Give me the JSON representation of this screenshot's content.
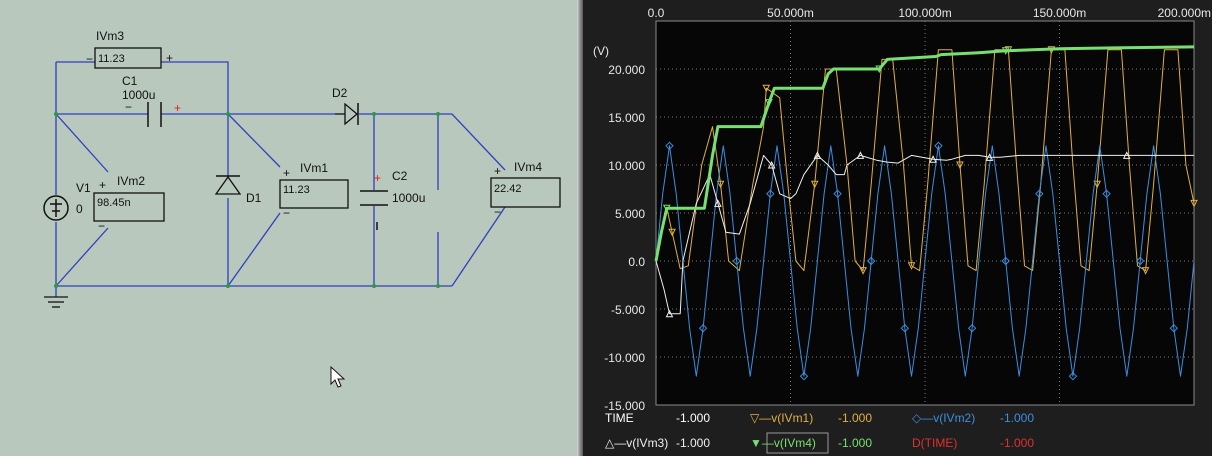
{
  "schematic": {
    "components": {
      "ivm3": {
        "name": "IVm3",
        "value": "11.23"
      },
      "c1": {
        "name": "C1",
        "value": "1000u"
      },
      "d2": {
        "name": "D2"
      },
      "v1": {
        "name": "V1",
        "value": "0"
      },
      "ivm2": {
        "name": "IVm2",
        "value": "98.45n"
      },
      "d1": {
        "name": "D1"
      },
      "ivm1": {
        "name": "IVm1",
        "value": "11.23"
      },
      "c2": {
        "name": "C2",
        "value": "1000u"
      },
      "ivm4": {
        "name": "IVm4",
        "value": "22.42"
      }
    },
    "polarity": {
      "plus": "+",
      "minus": "−"
    }
  },
  "colors": {
    "wire": "#2f3fc0",
    "ivm1": "#e0b040",
    "ivm2": "#3c8ee0",
    "ivm3": "#f0f0f0",
    "ivm4": "#77e071",
    "time_cursor": "#e03030",
    "plot_bg": "#060606",
    "grid": "#7a7a7a"
  },
  "chart_data": {
    "type": "line",
    "ylabel": "(V)",
    "x_ticks": [
      "0.0",
      "50.000m",
      "100.000m",
      "150.000m",
      "200.000m"
    ],
    "xlim": [
      0,
      0.2
    ],
    "y_ticks": [
      "20.000",
      "15.000",
      "10.000",
      "5.000",
      "0.0",
      "-5.000",
      "-10.000",
      "-15.000"
    ],
    "ylim": [
      -15,
      25
    ],
    "grid": true,
    "legend_position": "bottom",
    "series": [
      {
        "name": "v(IVm1)",
        "color": "#e0b040",
        "marker": "triangle-down",
        "points": [
          [
            0,
            0
          ],
          [
            0.004,
            5.5
          ],
          [
            0.006,
            3
          ],
          [
            0.009,
            -0.8
          ],
          [
            0.012,
            -0.5
          ],
          [
            0.017,
            10
          ],
          [
            0.021,
            14
          ],
          [
            0.024,
            8
          ],
          [
            0.027,
            0
          ],
          [
            0.031,
            -1
          ],
          [
            0.036,
            8
          ],
          [
            0.04,
            14
          ],
          [
            0.041,
            18
          ],
          [
            0.046,
            17
          ],
          [
            0.049,
            8
          ],
          [
            0.052,
            0
          ],
          [
            0.055,
            -1
          ],
          [
            0.059,
            8
          ],
          [
            0.063,
            20
          ],
          [
            0.067,
            20
          ],
          [
            0.071,
            10
          ],
          [
            0.074,
            0
          ],
          [
            0.077,
            -1
          ],
          [
            0.08,
            8
          ],
          [
            0.084,
            21
          ],
          [
            0.088,
            21
          ],
          [
            0.092,
            10
          ],
          [
            0.095,
            -0.5
          ],
          [
            0.098,
            -1
          ],
          [
            0.101,
            8
          ],
          [
            0.105,
            22
          ],
          [
            0.11,
            22
          ],
          [
            0.113,
            10
          ],
          [
            0.116,
            -0.5
          ],
          [
            0.119,
            -1
          ],
          [
            0.122,
            8
          ],
          [
            0.126,
            22
          ],
          [
            0.131,
            22
          ],
          [
            0.134,
            10
          ],
          [
            0.137,
            -0.5
          ],
          [
            0.14,
            -1
          ],
          [
            0.143,
            8
          ],
          [
            0.147,
            22
          ],
          [
            0.152,
            22
          ],
          [
            0.155,
            10
          ],
          [
            0.158,
            -0.5
          ],
          [
            0.161,
            -1
          ],
          [
            0.164,
            8
          ],
          [
            0.168,
            22
          ],
          [
            0.173,
            22
          ],
          [
            0.176,
            10
          ],
          [
            0.179,
            -0.5
          ],
          [
            0.182,
            -1
          ],
          [
            0.185,
            8
          ],
          [
            0.189,
            22
          ],
          [
            0.194,
            22
          ],
          [
            0.197,
            10
          ],
          [
            0.2,
            6
          ]
        ]
      },
      {
        "name": "v(IVm2)",
        "color": "#3c8ee0",
        "marker": "diamond",
        "points": [
          [
            0,
            0
          ],
          [
            0.0025,
            7
          ],
          [
            0.005,
            12
          ],
          [
            0.0075,
            7
          ],
          [
            0.01,
            0
          ],
          [
            0.0125,
            -7
          ],
          [
            0.015,
            -12
          ],
          [
            0.0175,
            -7
          ],
          [
            0.02,
            0
          ],
          [
            0.0225,
            7
          ],
          [
            0.025,
            12
          ],
          [
            0.0275,
            7
          ],
          [
            0.03,
            0
          ],
          [
            0.0325,
            -7
          ],
          [
            0.035,
            -12
          ],
          [
            0.0375,
            -7
          ],
          [
            0.04,
            0
          ],
          [
            0.0425,
            7
          ],
          [
            0.045,
            12
          ],
          [
            0.0475,
            7
          ],
          [
            0.05,
            0
          ],
          [
            0.0525,
            -7
          ],
          [
            0.055,
            -12
          ],
          [
            0.0575,
            -7
          ],
          [
            0.06,
            0
          ],
          [
            0.0625,
            7
          ],
          [
            0.065,
            12
          ],
          [
            0.0675,
            7
          ],
          [
            0.07,
            0
          ],
          [
            0.0725,
            -7
          ],
          [
            0.075,
            -12
          ],
          [
            0.0775,
            -7
          ],
          [
            0.08,
            0
          ],
          [
            0.0825,
            7
          ],
          [
            0.085,
            12
          ],
          [
            0.0875,
            7
          ],
          [
            0.09,
            0
          ],
          [
            0.0925,
            -7
          ],
          [
            0.095,
            -12
          ],
          [
            0.0975,
            -7
          ],
          [
            0.1,
            0
          ],
          [
            0.1025,
            7
          ],
          [
            0.105,
            12
          ],
          [
            0.1075,
            7
          ],
          [
            0.11,
            0
          ],
          [
            0.1125,
            -7
          ],
          [
            0.115,
            -12
          ],
          [
            0.1175,
            -7
          ],
          [
            0.12,
            0
          ],
          [
            0.1225,
            7
          ],
          [
            0.125,
            12
          ],
          [
            0.1275,
            7
          ],
          [
            0.13,
            0
          ],
          [
            0.1325,
            -7
          ],
          [
            0.135,
            -12
          ],
          [
            0.1375,
            -7
          ],
          [
            0.14,
            0
          ],
          [
            0.1425,
            7
          ],
          [
            0.145,
            12
          ],
          [
            0.1475,
            7
          ],
          [
            0.15,
            0
          ],
          [
            0.1525,
            -7
          ],
          [
            0.155,
            -12
          ],
          [
            0.1575,
            -7
          ],
          [
            0.16,
            0
          ],
          [
            0.1625,
            7
          ],
          [
            0.165,
            12
          ],
          [
            0.1675,
            7
          ],
          [
            0.17,
            0
          ],
          [
            0.1725,
            -7
          ],
          [
            0.175,
            -12
          ],
          [
            0.1775,
            -7
          ],
          [
            0.18,
            0
          ],
          [
            0.1825,
            7
          ],
          [
            0.185,
            12
          ],
          [
            0.1875,
            7
          ],
          [
            0.19,
            0
          ],
          [
            0.1925,
            -7
          ],
          [
            0.195,
            -12
          ],
          [
            0.1975,
            -7
          ],
          [
            0.2,
            0
          ]
        ]
      },
      {
        "name": "v(IVm3)",
        "color": "#f0f0f0",
        "marker": "triangle-up",
        "points": [
          [
            0,
            0
          ],
          [
            0.003,
            -3
          ],
          [
            0.005,
            -5.5
          ],
          [
            0.009,
            -5.5
          ],
          [
            0.01,
            0
          ],
          [
            0.015,
            6
          ],
          [
            0.02,
            9
          ],
          [
            0.023,
            6
          ],
          [
            0.026,
            3
          ],
          [
            0.031,
            2.8
          ],
          [
            0.035,
            6
          ],
          [
            0.04,
            11
          ],
          [
            0.043,
            10
          ],
          [
            0.046,
            7
          ],
          [
            0.05,
            6.5
          ],
          [
            0.052,
            7
          ],
          [
            0.055,
            9
          ],
          [
            0.06,
            11
          ],
          [
            0.064,
            10
          ],
          [
            0.067,
            9
          ],
          [
            0.07,
            9
          ],
          [
            0.071,
            10
          ],
          [
            0.076,
            11
          ],
          [
            0.082,
            10.5
          ],
          [
            0.086,
            10.3
          ],
          [
            0.09,
            10.2
          ],
          [
            0.095,
            11
          ],
          [
            0.103,
            10.6
          ],
          [
            0.108,
            10.5
          ],
          [
            0.11,
            10.6
          ],
          [
            0.115,
            11
          ],
          [
            0.12,
            11
          ],
          [
            0.124,
            10.8
          ],
          [
            0.128,
            10.8
          ],
          [
            0.135,
            11
          ],
          [
            0.145,
            11
          ],
          [
            0.16,
            11
          ],
          [
            0.175,
            11
          ],
          [
            0.19,
            11
          ],
          [
            0.2,
            11
          ]
        ]
      },
      {
        "name": "v(IVm4)",
        "color": "#77e071",
        "marker": "triangle-down",
        "points": [
          [
            0,
            0
          ],
          [
            0.002,
            3
          ],
          [
            0.004,
            5.5
          ],
          [
            0.018,
            5.5
          ],
          [
            0.021,
            11
          ],
          [
            0.023,
            14
          ],
          [
            0.039,
            14
          ],
          [
            0.042,
            16.5
          ],
          [
            0.044,
            18
          ],
          [
            0.062,
            18
          ],
          [
            0.064,
            19.5
          ],
          [
            0.066,
            20
          ],
          [
            0.083,
            20
          ],
          [
            0.086,
            21
          ],
          [
            0.104,
            21.3
          ],
          [
            0.106,
            21.5
          ],
          [
            0.12,
            21.7
          ],
          [
            0.13,
            21.9
          ],
          [
            0.15,
            22.1
          ],
          [
            0.17,
            22.2
          ],
          [
            0.2,
            22.3
          ]
        ]
      }
    ]
  },
  "legend": {
    "row1": [
      {
        "label": "TIME",
        "value": "-1.000",
        "color": "#ffffff",
        "marker": ""
      },
      {
        "label": "v(IVm1)",
        "value": "-1.000",
        "color": "#e0b040",
        "marker": "▽"
      },
      {
        "label": "v(IVm2)",
        "value": "-1.000",
        "color": "#3c8ee0",
        "marker": "◇"
      }
    ],
    "row2": [
      {
        "label": "v(IVm3)",
        "value": "-1.000",
        "color": "#f0f0f0",
        "marker": "△"
      },
      {
        "label": "v(IVm4)",
        "value": "-1.000",
        "color": "#77e071",
        "marker": "▼"
      },
      {
        "label": "D(TIME)",
        "value": "-1.000",
        "color": "#e03030",
        "marker": ""
      }
    ]
  }
}
